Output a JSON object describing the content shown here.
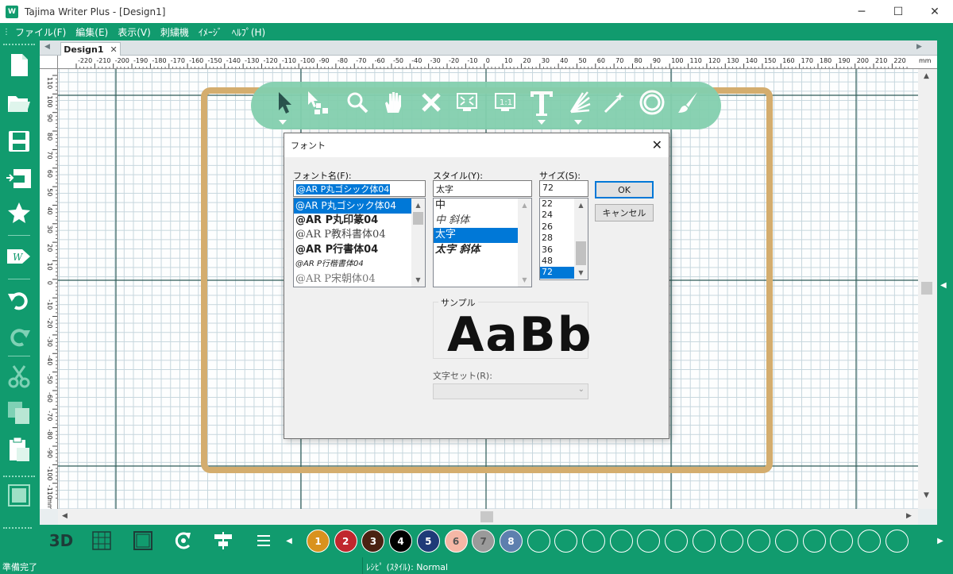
{
  "window": {
    "title": "Tajima Writer Plus - [Design1]",
    "app_icon_text": "W",
    "minimize": "─",
    "maximize": "☐",
    "close": "✕"
  },
  "menu": [
    "ファイル(F)",
    "編集(E)",
    "表示(V)",
    "刺繍機",
    "ｲﾒｰｼﾞ",
    "ﾍﾙﾌﾟ(H)"
  ],
  "tab": {
    "label": "Design1",
    "close": "✕"
  },
  "ruler": {
    "top_ticks": [
      "-220",
      "-210",
      "-200",
      "-190",
      "-180",
      "-170",
      "-160",
      "-150",
      "-140",
      "-130",
      "-120",
      "-110",
      "-100",
      "-90",
      "-80",
      "-70",
      "-60",
      "-50",
      "-40",
      "-30",
      "-20",
      "-10",
      "0",
      "10",
      "20",
      "30",
      "40",
      "50",
      "60",
      "70",
      "80",
      "90",
      "100",
      "110",
      "120",
      "130",
      "140",
      "150",
      "160",
      "170",
      "180",
      "190",
      "200",
      "210",
      "220"
    ],
    "unit": "mm",
    "left_ticks": [
      "110",
      "100",
      "90",
      "80",
      "70",
      "60",
      "50",
      "40",
      "30",
      "20",
      "10",
      "0",
      "-10",
      "-20",
      "-30",
      "-40",
      "-50",
      "-60",
      "-70",
      "-80",
      "-90",
      "-100",
      "-110"
    ],
    "left_unit": "mm"
  },
  "dialog": {
    "title": "フォント",
    "font_label": "フォント名(F):",
    "font_value": "@AR P丸ゴシック体04",
    "fonts": [
      "@AR P丸ゴシック体04",
      "@AR P丸印篆04",
      "@AR P教科書体04",
      "@AR P行書体04",
      "@AR P行楷書体04",
      "@AR P宋朝体04"
    ],
    "style_label": "スタイル(Y):",
    "style_value": "太字",
    "styles": [
      "中",
      "中 斜体",
      "太字",
      "太字 斜体"
    ],
    "size_label": "サイズ(S):",
    "size_value": "72",
    "sizes": [
      "22",
      "24",
      "26",
      "28",
      "36",
      "48",
      "72"
    ],
    "ok": "OK",
    "cancel": "キャンセル",
    "sample_label": "サンプル",
    "sample_text": "AaBb",
    "charset_label": "文字セット(R):",
    "charset_value": ""
  },
  "bottom": {
    "btn_3d": "3D",
    "swatches": [
      {
        "num": "1",
        "color": "#d9921e"
      },
      {
        "num": "2",
        "color": "#c0272d"
      },
      {
        "num": "3",
        "color": "#4a2212"
      },
      {
        "num": "4",
        "color": "#000000"
      },
      {
        "num": "5",
        "color": "#1f3a78"
      },
      {
        "num": "6",
        "color": "#f5b7a6"
      },
      {
        "num": "7",
        "color": "#9a9a9a"
      },
      {
        "num": "8",
        "color": "#5d7fae"
      }
    ]
  },
  "status": {
    "left": "準備完了",
    "mid": "ﾚｼﾋﾟ (ｽﾀｲﾙ): Normal"
  },
  "colors": {
    "brand": "#119b6e",
    "hoop": "#d4ad6e",
    "selection": "#0078d7"
  }
}
